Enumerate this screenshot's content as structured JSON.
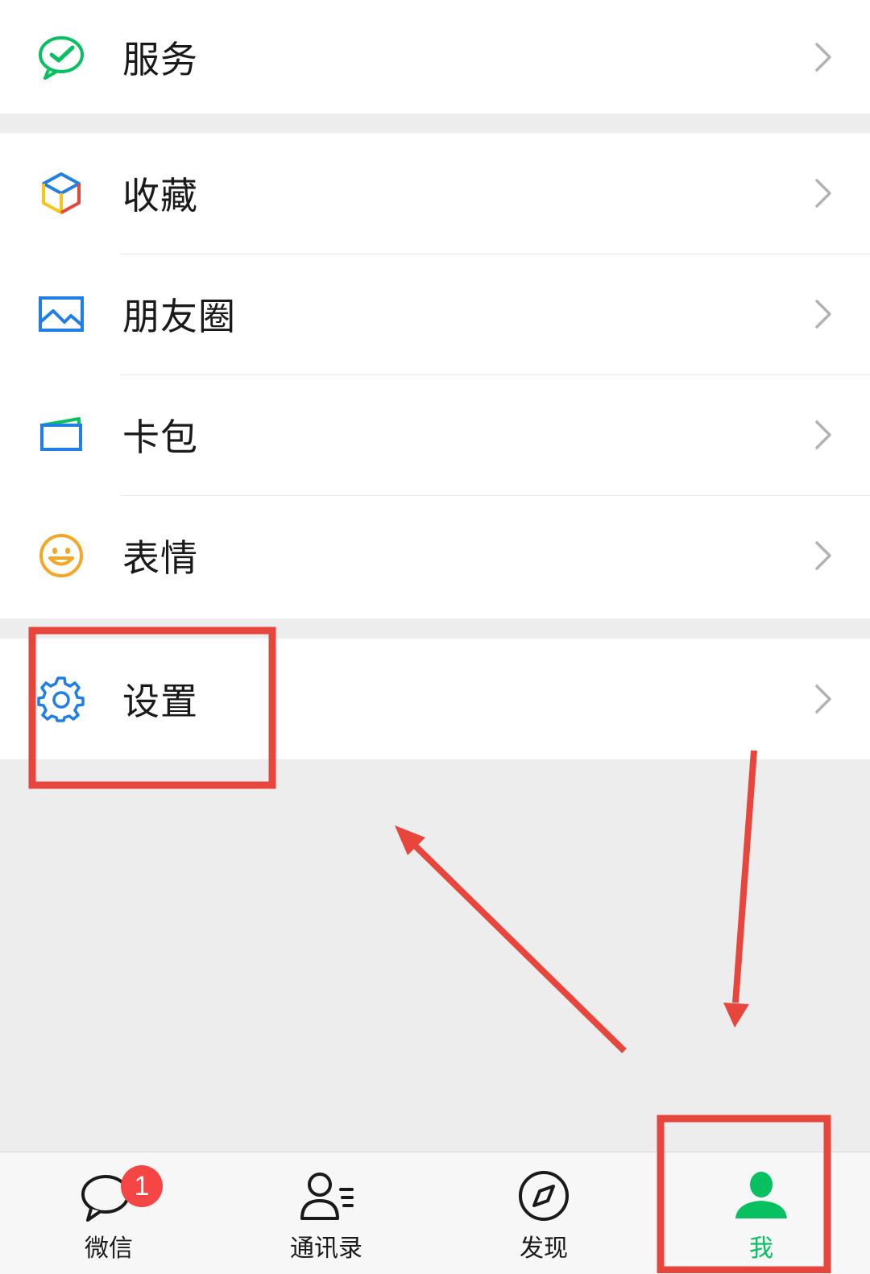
{
  "menu_groups": [
    {
      "items": [
        {
          "label": "服务",
          "icon": "wechat-pay-service-icon",
          "icon_color": "#07c160"
        }
      ]
    },
    {
      "items": [
        {
          "label": "收藏",
          "icon": "favorites-cube-icon",
          "icon_color": "#f5a623"
        },
        {
          "label": "朋友圈",
          "icon": "moments-picture-icon",
          "icon_color": "#1f7ee8"
        },
        {
          "label": "卡包",
          "icon": "card-wallet-icon",
          "icon_color": "#1f7ee8"
        },
        {
          "label": "表情",
          "icon": "sticker-smile-icon",
          "icon_color": "#f5a623"
        }
      ]
    },
    {
      "items": [
        {
          "label": "设置",
          "icon": "settings-gear-icon",
          "icon_color": "#1f7ee8"
        }
      ]
    }
  ],
  "tabbar": {
    "tabs": [
      {
        "label": "微信",
        "icon": "chat-bubble-icon",
        "badge": "1",
        "active": false
      },
      {
        "label": "通讯录",
        "icon": "contacts-icon",
        "active": false
      },
      {
        "label": "发现",
        "icon": "compass-icon",
        "active": false
      },
      {
        "label": "我",
        "icon": "me-person-icon",
        "active": true
      }
    ]
  },
  "colors": {
    "accent": "#07c160",
    "annotation": "#e8453c",
    "badge": "#f54545",
    "background": "#ededed"
  }
}
